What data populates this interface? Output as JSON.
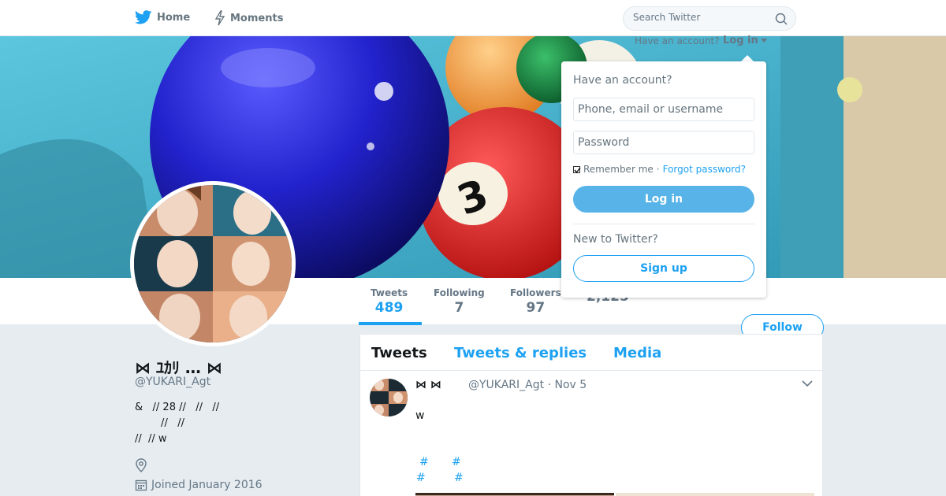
{
  "nav": {
    "home_label": "Home",
    "moments_label": "Moments",
    "search_placeholder": "Search Twitter",
    "brand_color": "#1da1f2"
  },
  "profile": {
    "name": "⋈ ﾕｶﾘ … ⋈",
    "handle": "@YUKARI_Agt",
    "bio_lines": [
      "&   // 28 //   //   //",
      "        //   //",
      "//  // w"
    ],
    "joined": "Joined January 2016"
  },
  "stats": [
    {
      "label": "Tweets",
      "value": "489"
    },
    {
      "label": "Following",
      "value": "7"
    },
    {
      "label": "Followers",
      "value": "97"
    },
    {
      "label": "",
      "value": "2,125"
    }
  ],
  "follow_label": "Follow",
  "tabs": [
    {
      "label": "Tweets"
    },
    {
      "label": "Tweets & replies"
    },
    {
      "label": "Media"
    }
  ],
  "tweet": {
    "name": "⋈  ⋈",
    "meta": "@YUKARI_Agt · Nov 5",
    "text": "w",
    "hashtags": [
      "#",
      "#",
      "#",
      "#"
    ]
  },
  "login": {
    "have_account_text": "Have an account?",
    "login_link": "Log in",
    "dropdown_title": "Have an account?",
    "username_placeholder": "Phone, email or username",
    "password_placeholder": "Password",
    "remember_label": "Remember me",
    "separator": "·",
    "forgot_label": "Forgot password?",
    "login_button": "Log in",
    "new_text": "New to Twitter?",
    "signup_button": "Sign up"
  }
}
